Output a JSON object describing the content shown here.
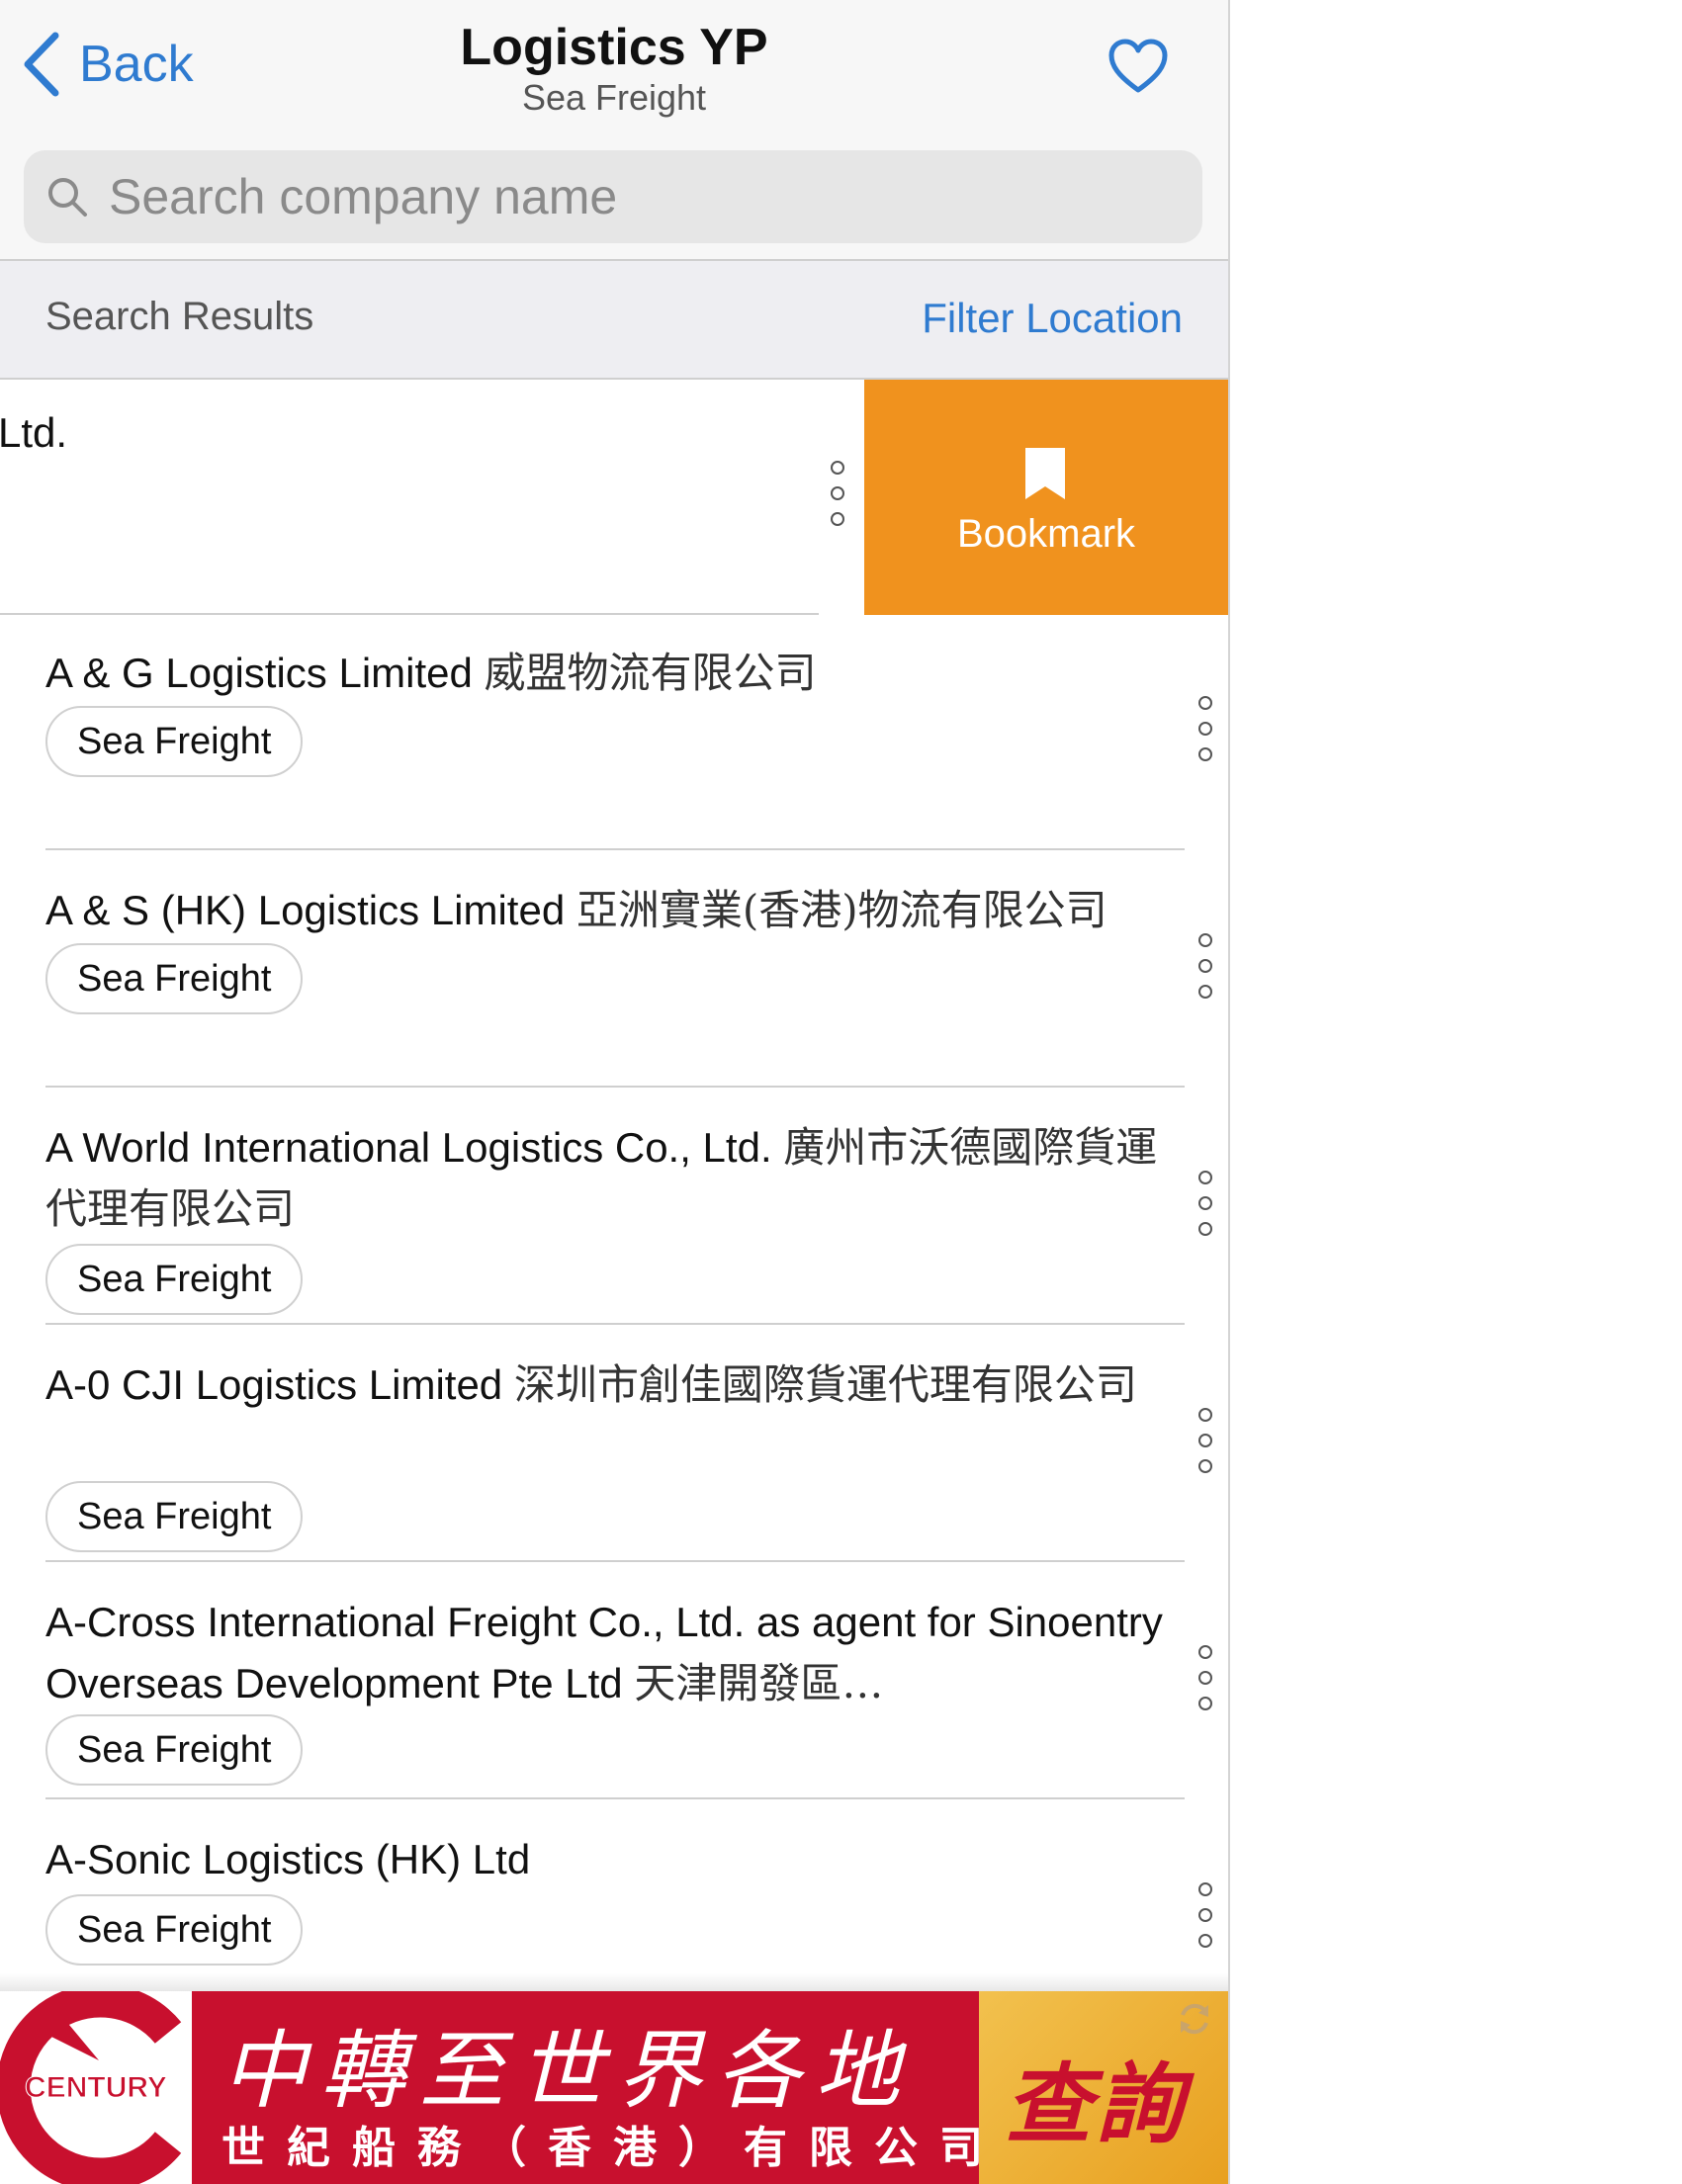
{
  "header": {
    "back_label": "Back",
    "title": "Logistics YP",
    "subtitle": "Sea Freight"
  },
  "search": {
    "placeholder": "Search company name"
  },
  "results_bar": {
    "title": "Search Results",
    "filter_label": "Filter Location"
  },
  "swiped_row": {
    "visible_text": "Ltd.",
    "action_label": "Bookmark"
  },
  "list": [
    {
      "name": "A & G Logistics Limited",
      "name_zh": "威盟物流有限公司",
      "tag": "Sea Freight"
    },
    {
      "name": "A & S (HK) Logistics Limited",
      "name_zh": "亞洲實業(香港)物流有限公司",
      "tag": "Sea Freight"
    },
    {
      "name": "A World International Logistics Co., Ltd.",
      "name_zh": "廣州市沃德國際貨運代理有限公司",
      "tag": "Sea Freight"
    },
    {
      "name": "A-0 CJI Logistics Limited",
      "name_zh": "深圳市創佳國際貨運代理有限公司",
      "tag": "Sea Freight"
    },
    {
      "name": "A-Cross International Freight Co., Ltd. as agent for Sinoentry Overseas Development Pte Ltd",
      "name_zh": "天津開發區…",
      "tag": "Sea Freight"
    },
    {
      "name": "A-Sonic Logistics (HK) Ltd",
      "name_zh": "",
      "tag": "Sea Freight"
    }
  ],
  "ad": {
    "logo_text": "CENTURY",
    "headline": "中轉至世界各地",
    "company": "世紀船務（香港）有限公司",
    "cta": "查詢"
  },
  "colors": {
    "accent": "#2f7bd0",
    "bookmark": "#f0921e",
    "ad_red": "#c8102e",
    "ad_gold": "#f2c14e"
  }
}
